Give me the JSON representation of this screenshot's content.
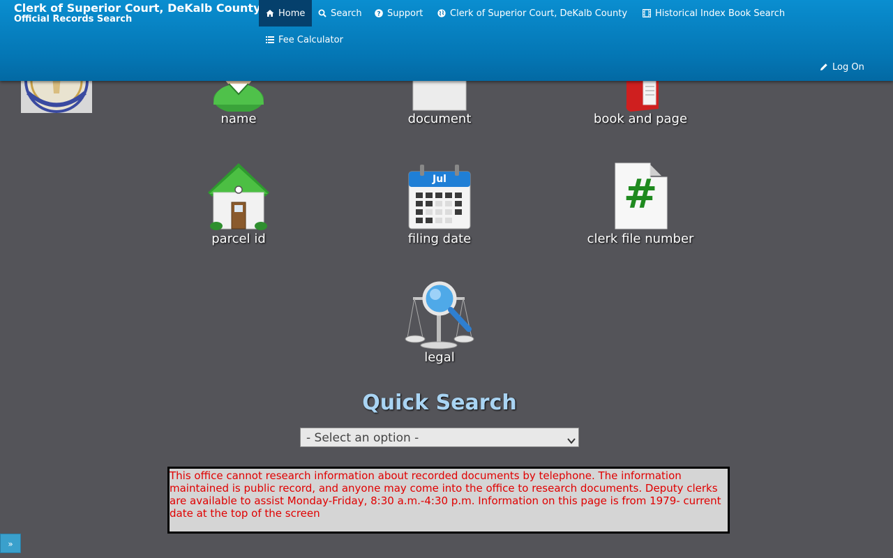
{
  "brand": {
    "title": "Clerk of Superior Court, DeKalb County",
    "subtitle": "Official Records Search"
  },
  "nav": {
    "home": "Home",
    "search": "Search",
    "support": "Support",
    "clerk": "Clerk of Superior Court, DeKalb County",
    "historical": "Historical Index Book Search",
    "fee": "Fee Calculator",
    "logon": "Log On"
  },
  "tiles": {
    "name": "name",
    "document": "document",
    "book_and_page": "book and page",
    "parcel_id": "parcel id",
    "filing_date": "filing date",
    "calendar_month": "Jul",
    "clerk_file_number": "clerk file number",
    "file_symbol": "#",
    "legal": "legal"
  },
  "quick_search": {
    "title": "Quick Search",
    "selected": "- Select an option -"
  },
  "notice": {
    "text": " This office cannot research information about recorded documents by telephone. The information maintained is public record, and anyone may come into the office to research documents. Deputy clerks are available to assist Monday-Friday, 8:30 a.m.-4:30 p.m. Information on this page is from 1979- current date at the top of the screen"
  },
  "side_toggle": {
    "label": "»"
  },
  "colors": {
    "header": "#0476b4",
    "active_nav": "#05406c",
    "page_bg": "#545459",
    "quick_search_title": "#a9d4f3",
    "notice_text": "#e00000"
  }
}
